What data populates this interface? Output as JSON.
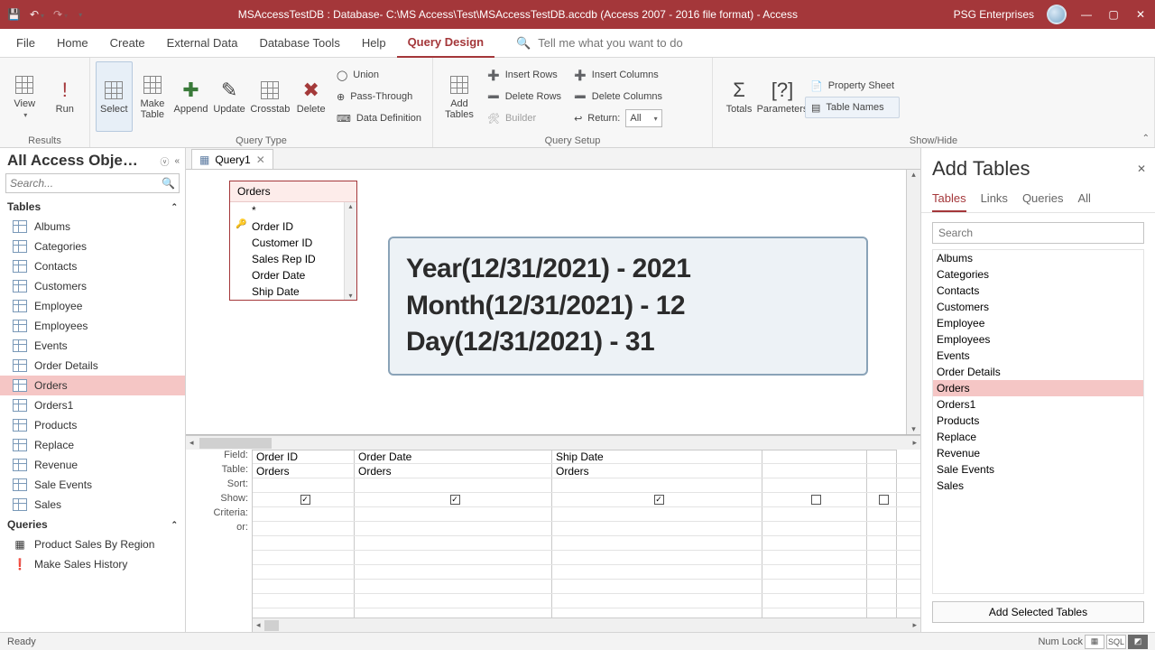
{
  "titlebar": {
    "title": "MSAccessTestDB : Database- C:\\MS Access\\Test\\MSAccessTestDB.accdb (Access 2007 - 2016 file format)  -  Access",
    "org": "PSG Enterprises"
  },
  "ribbon_tabs": {
    "file": "File",
    "home": "Home",
    "create": "Create",
    "external": "External Data",
    "dbtools": "Database Tools",
    "help": "Help",
    "query_design": "Query Design",
    "tellme_placeholder": "Tell me what you want to do"
  },
  "ribbon": {
    "results": {
      "view": "View",
      "run": "Run",
      "label": "Results"
    },
    "query_type": {
      "select": "Select",
      "make_table": "Make\nTable",
      "append": "Append",
      "update": "Update",
      "crosstab": "Crosstab",
      "delete": "Delete",
      "union": "Union",
      "passthrough": "Pass-Through",
      "datadef": "Data Definition",
      "label": "Query Type"
    },
    "query_setup": {
      "add_tables": "Add\nTables",
      "insert_rows": "Insert Rows",
      "delete_rows": "Delete Rows",
      "builder": "Builder",
      "insert_cols": "Insert Columns",
      "delete_cols": "Delete Columns",
      "return": "Return:",
      "return_val": "All",
      "label": "Query Setup"
    },
    "showhide": {
      "totals": "Totals",
      "parameters": "Parameters",
      "property_sheet": "Property Sheet",
      "table_names": "Table Names",
      "label": "Show/Hide"
    }
  },
  "nav": {
    "header": "All Access Obje…",
    "search_placeholder": "Search...",
    "group_tables": "Tables",
    "group_queries": "Queries",
    "tables": [
      "Albums",
      "Categories",
      "Contacts",
      "Customers",
      "Employee",
      "Employees",
      "Events",
      "Order Details",
      "Orders",
      "Orders1",
      "Products",
      "Replace",
      "Revenue",
      "Sale Events",
      "Sales"
    ],
    "tables_selected": "Orders",
    "queries": [
      "Product Sales By Region",
      "Make Sales History"
    ]
  },
  "doc_tab": "Query1",
  "fieldlist": {
    "title": "Orders",
    "rows": [
      {
        "label": "*",
        "key": false
      },
      {
        "label": "Order ID",
        "key": true
      },
      {
        "label": "Customer ID",
        "key": false
      },
      {
        "label": "Sales Rep ID",
        "key": false
      },
      {
        "label": "Order Date",
        "key": false
      },
      {
        "label": "Ship Date",
        "key": false
      }
    ]
  },
  "callout": {
    "l1": "Year(12/31/2021) - 2021",
    "l2": "Month(12/31/2021) - 12",
    "l3": "Day(12/31/2021) - 31"
  },
  "qbe": {
    "labels": [
      "Field:",
      "Table:",
      "Sort:",
      "Show:",
      "Criteria:",
      "or:"
    ],
    "cols": [
      {
        "field": "Order ID",
        "table": "Orders",
        "show": true
      },
      {
        "field": "Order Date",
        "table": "Orders",
        "show": true
      },
      {
        "field": "Ship Date",
        "table": "Orders",
        "show": true
      },
      {
        "field": "",
        "table": "",
        "show": false
      },
      {
        "field": "",
        "table": "",
        "show": false
      }
    ]
  },
  "addpane": {
    "title": "Add Tables",
    "tabs": {
      "tables": "Tables",
      "links": "Links",
      "queries": "Queries",
      "all": "All"
    },
    "search_placeholder": "Search",
    "list": [
      "Albums",
      "Categories",
      "Contacts",
      "Customers",
      "Employee",
      "Employees",
      "Events",
      "Order Details",
      "Orders",
      "Orders1",
      "Products",
      "Replace",
      "Revenue",
      "Sale Events",
      "Sales"
    ],
    "selected": "Orders",
    "button": "Add Selected Tables"
  },
  "status": {
    "ready": "Ready",
    "numlock": "Num Lock",
    "sql": "SQL"
  }
}
